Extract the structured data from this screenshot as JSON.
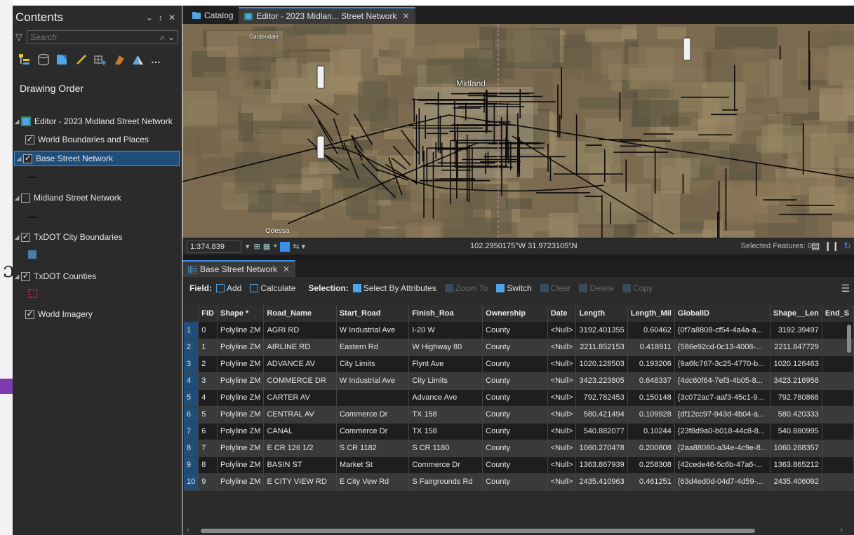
{
  "contents": {
    "title": "Contents",
    "search_placeholder": "Search",
    "drawing_order": "Drawing Order",
    "layers": [
      {
        "label": "Editor - 2023 Midland Street Network",
        "checked": false
      },
      {
        "label": "World Boundaries and Places",
        "checked": true
      },
      {
        "label": "Base Street Network",
        "checked": true
      },
      {
        "label": "Midland Street Network",
        "checked": false
      },
      {
        "label": "TxDOT City Boundaries",
        "checked": true
      },
      {
        "label": "TxDOT Counties",
        "checked": true
      },
      {
        "label": "World Imagery",
        "checked": true
      }
    ]
  },
  "tabs": {
    "catalog": "Catalog",
    "editor": "Editor - 2023 Midlan... Street Network"
  },
  "map": {
    "labels": {
      "midland": "Midland",
      "gardendale": "Gardendale",
      "odessa": "Odessa"
    },
    "scale": "1:374,839",
    "coordinates": "102.2950175°W 31.9723105°N",
    "selected_features": "Selected Features: 0"
  },
  "table_tab": "Base Street Network",
  "toolbar": {
    "field_label": "Field:",
    "add": "Add",
    "calculate": "Calculate",
    "selection_label": "Selection:",
    "select_by_attributes": "Select By Attributes",
    "zoom_to": "Zoom To",
    "switch": "Switch",
    "clear": "Clear",
    "delete": "Delete",
    "copy": "Copy"
  },
  "columns": [
    "",
    "FID",
    "Shape *",
    "Road_Name",
    "Start_Road",
    "Finish_Roa",
    "Ownership",
    "Date",
    "Length",
    "Length_Mil",
    "GlobalID",
    "Shape__Len",
    "End_S"
  ],
  "rows": [
    [
      "1",
      "0",
      "Polyline ZM",
      "AGRI RD",
      "W Industrial Ave",
      "I-20 W",
      "County",
      "<Null>",
      "3192.401355",
      "0.60462",
      "{0f7a8808-cf54-4a4a-a...",
      "3192.39497",
      ""
    ],
    [
      "2",
      "1",
      "Polyline ZM",
      "AIRLINE RD",
      "Eastern Rd",
      "W Highway 80",
      "County",
      "<Null>",
      "2211.852153",
      "0.418911",
      "{586e92cd-0c13-4008-...",
      "2211.847729",
      ""
    ],
    [
      "3",
      "2",
      "Polyline ZM",
      "ADVANCE AV",
      "City Limits",
      "Flynt Ave",
      "County",
      "<Null>",
      "1020.128503",
      "0.193206",
      "{9a6fc767-3c25-4770-b...",
      "1020.126463",
      ""
    ],
    [
      "4",
      "3",
      "Polyline ZM",
      "COMMERCE DR",
      "W Industrial Ave",
      "City Limits",
      "County",
      "<Null>",
      "3423.223805",
      "0.648337",
      "{4dc60f64-7ef3-4b05-8...",
      "3423.216958",
      ""
    ],
    [
      "5",
      "4",
      "Polyline ZM",
      "CARTER AV",
      "",
      "Advance Ave",
      "County",
      "<Null>",
      "792.782453",
      "0.150148",
      "{3c072ac7-aaf3-45c1-9...",
      "792.780868",
      ""
    ],
    [
      "6",
      "5",
      "Polyline ZM",
      "CENTRAL AV",
      "Commerce Dr",
      "TX 158",
      "County",
      "<Null>",
      "580.421494",
      "0.109928",
      "{df12cc97-943d-4b04-a...",
      "580.420333",
      ""
    ],
    [
      "7",
      "6",
      "Polyline ZM",
      "CANAL",
      "Commerce Dr",
      "TX 158",
      "County",
      "<Null>",
      "540.882077",
      "0.10244",
      "{23f8d9a0-b018-44c8-8...",
      "540.880995",
      ""
    ],
    [
      "8",
      "7",
      "Polyline ZM",
      "E CR 126 1/2",
      "S CR 1182",
      "S CR 1180",
      "County",
      "<Null>",
      "1060.270478",
      "0.200808",
      "{2aa88080-a34e-4c9e-8...",
      "1060.268357",
      ""
    ],
    [
      "9",
      "8",
      "Polyline ZM",
      "BASIN ST",
      "Market St",
      "Commerce Dr",
      "County",
      "<Null>",
      "1363.867939",
      "0.258308",
      "{42cede46-5c6b-47a6-...",
      "1363.865212",
      ""
    ],
    [
      "10",
      "9",
      "Polyline ZM",
      "E CITY VIEW RD",
      "E City Vew Rd",
      "S Fairgrounds Rd",
      "County",
      "<Null>",
      "2435.410963",
      "0.461251",
      "{63d4ed0d-04d7-4d59-...",
      "2435.406092",
      ""
    ]
  ]
}
